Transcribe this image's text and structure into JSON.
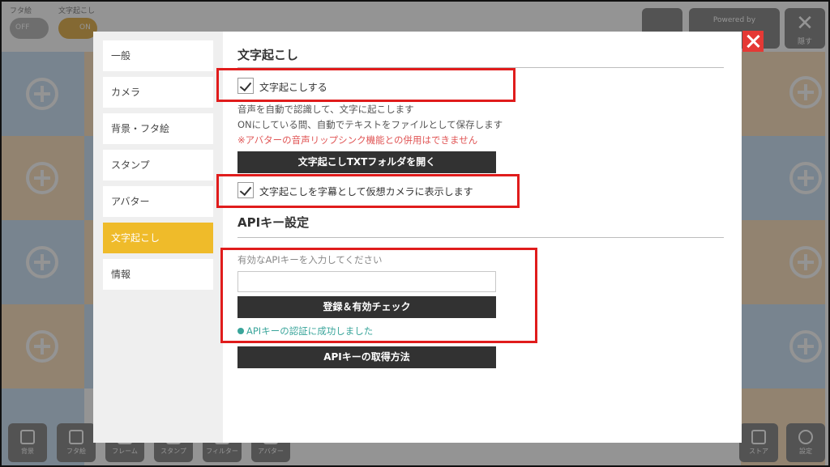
{
  "top": {
    "toggles": [
      {
        "label": "フタ絵",
        "state": "OFF"
      },
      {
        "label": "文字起こし",
        "state": "ON"
      }
    ],
    "powered_by": "Powered by",
    "hide_label": "隠す"
  },
  "sidebar": {
    "items": [
      {
        "label": "一般"
      },
      {
        "label": "カメラ"
      },
      {
        "label": "背景・フタ絵"
      },
      {
        "label": "スタンプ"
      },
      {
        "label": "アバター"
      },
      {
        "label": "文字起こし",
        "active": true
      },
      {
        "label": "情報"
      }
    ]
  },
  "transcription": {
    "title": "文字起こし",
    "enable_label": "文字起こしする",
    "desc1": "音声を自動で認識して、文字に起こします",
    "desc2": "ONにしている間、自動でテキストをファイルとして保存します",
    "warning": "※アバターの音声リップシンク機能との併用はできません",
    "open_folder_button": "文字起こしTXTフォルダを開く",
    "subtitle_label": "文字起こしを字幕として仮想カメラに表示します"
  },
  "api": {
    "title": "APIキー設定",
    "input_label": "有効なAPIキーを入力してください",
    "input_value": "",
    "register_button": "登録＆有効チェック",
    "status": "APIキーの認証に成功しました",
    "howto_button": "APIキーの取得方法"
  },
  "bottom": {
    "tools": [
      "背景",
      "フタ絵",
      "フレーム",
      "スタンプ",
      "フィルター",
      "アバター"
    ],
    "right_tools": [
      "ストア",
      "設定"
    ]
  },
  "colors": {
    "accent": "#efbb2a",
    "highlight": "#e01c1c",
    "success": "#3aa59b",
    "warning": "#e05555"
  }
}
